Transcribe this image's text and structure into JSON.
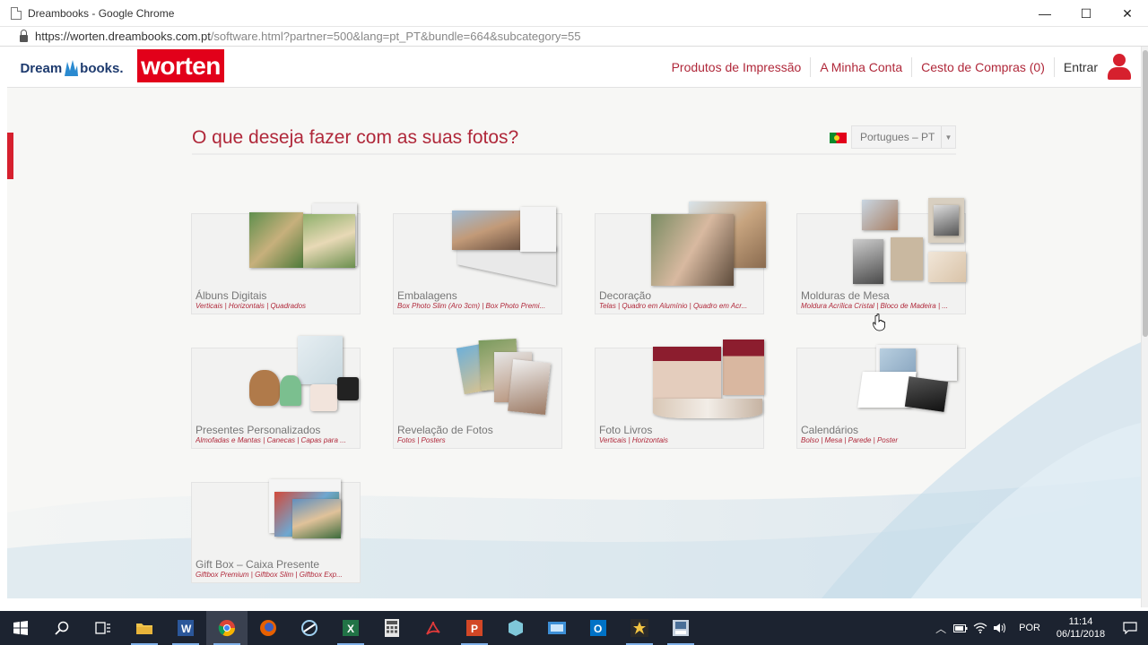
{
  "window": {
    "title": "Dreambooks - Google Chrome",
    "controls": {
      "minimize": "—",
      "maximize": "☐",
      "close": "✕"
    }
  },
  "address_bar": {
    "url_host": "https://worten.dreambooks.com.pt",
    "url_path": "/software.html?partner=500&lang=pt_PT&bundle=664&subcategory=55"
  },
  "header": {
    "logo_dream_left": "Dream",
    "logo_dream_right": "books.",
    "logo_worten": "worten",
    "nav": [
      {
        "label": "Produtos de Impressão"
      },
      {
        "label": "A Minha Conta"
      },
      {
        "label": "Cesto de Compras (0)"
      }
    ],
    "login_label": "Entrar"
  },
  "main": {
    "question": "O que deseja fazer com as suas fotos?",
    "language_select": {
      "value": "Portugues – PT",
      "caret": "▼"
    },
    "products": [
      {
        "title": "Álbuns Digitais",
        "subtitle": "Verticais | Horizontais | Quadrados"
      },
      {
        "title": "Embalagens",
        "subtitle": "Box Photo Slim (Aro 3cm) | Box Photo Premi..."
      },
      {
        "title": "Decoração",
        "subtitle": "Telas | Quadro em Alumínio | Quadro em Acr..."
      },
      {
        "title": "Molduras de Mesa",
        "subtitle": "Moldura Acrílica Cristal | Bloco de Madeira | ..."
      },
      {
        "title": "Presentes Personalizados",
        "subtitle": "Almofadas e Mantas | Canecas | Capas para ..."
      },
      {
        "title": "Revelação de Fotos",
        "subtitle": "Fotos | Posters"
      },
      {
        "title": "Foto Livros",
        "subtitle": "Verticais | Horizontais"
      },
      {
        "title": "Calendários",
        "subtitle": "Bolso | Mesa | Parede | Poster"
      },
      {
        "title": "Gift Box – Caixa Presente",
        "subtitle": "Giftbox Premium | Giftbox Slim | Giftbox Exp..."
      }
    ]
  },
  "taskbar": {
    "apps": [
      "start-icon",
      "search-icon",
      "task-view-icon",
      "file-explorer-icon",
      "word-icon",
      "chrome-icon",
      "firefox-icon",
      "app-icon",
      "excel-icon",
      "calculator-icon",
      "pdf-icon",
      "powerpoint-icon",
      "app-icon-2",
      "app-icon-3",
      "outlook-icon",
      "media-icon",
      "app-icon-4"
    ],
    "tray": {
      "language": "POR",
      "time": "11:14",
      "date": "06/11/2018"
    }
  },
  "colors": {
    "brand_red": "#b0283a",
    "worten_red": "#e2001a",
    "dreambooks_blue": "#1d3a6e"
  }
}
